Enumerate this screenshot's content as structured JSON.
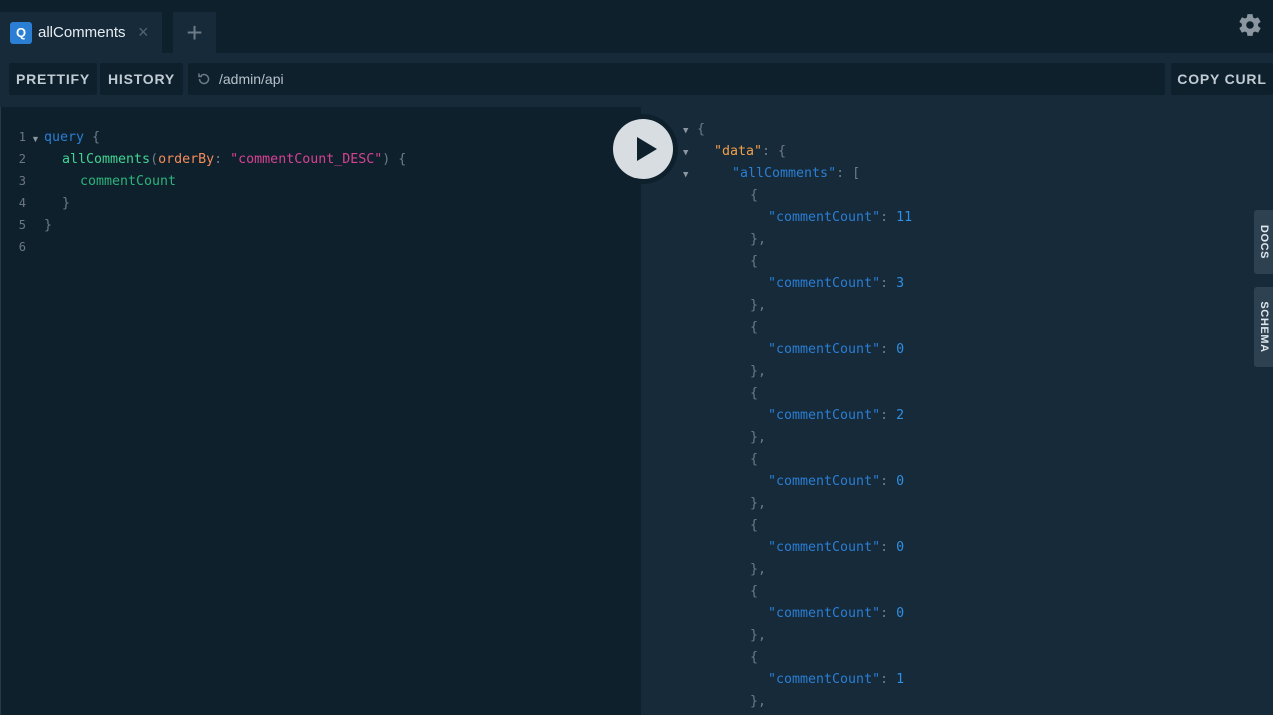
{
  "tabs": [
    {
      "badge": "Q",
      "title": "allComments",
      "close": "×"
    }
  ],
  "add_tab_label": "+",
  "toolbar": {
    "prettify": "PRETTIFY",
    "history": "HISTORY",
    "endpoint": "/admin/api",
    "copy_curl": "COPY CURL"
  },
  "editor": {
    "line_numbers": [
      "1",
      "2",
      "3",
      "4",
      "5",
      "6"
    ],
    "keyword": "query",
    "open_brace": "{",
    "field": "allComments",
    "arg_name": "orderBy",
    "colon": ":",
    "arg_value": "\"commentCount_DESC\"",
    "paren_open": "(",
    "paren_close": ")",
    "inner_field": "commentCount",
    "close_brace": "}"
  },
  "result": {
    "open": "{",
    "data_key": "\"data\"",
    "list_key": "\"allComments\"",
    "field_key": "\"commentCount\"",
    "comment_counts": [
      "11",
      "3",
      "0",
      "2",
      "0",
      "0",
      "0",
      "1"
    ]
  },
  "side_tabs": {
    "docs": "DOCS",
    "schema": "SCHEMA"
  },
  "colors": {
    "accent": "#2a7ed3",
    "background": "#172a3a",
    "editor_bg": "#0f202d"
  }
}
